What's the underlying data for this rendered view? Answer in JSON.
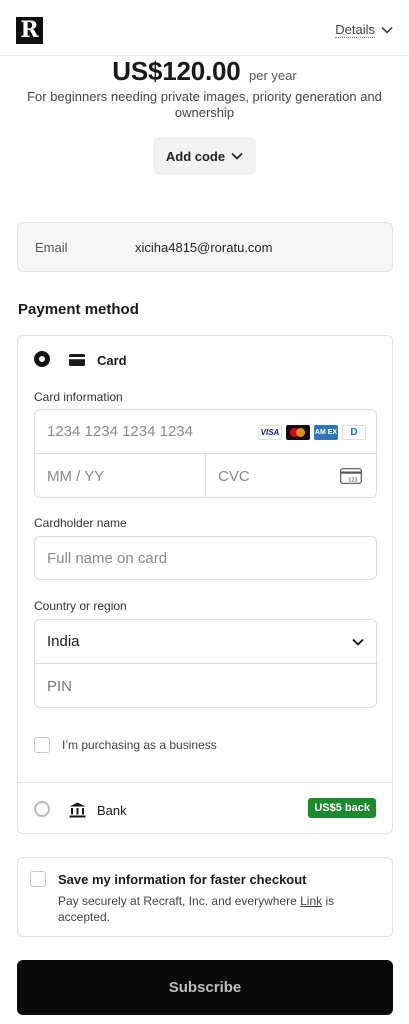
{
  "header": {
    "logo_text": "R",
    "details_label": "Details"
  },
  "plan": {
    "price": "US$120.00",
    "period": "per year",
    "description": "For beginners needing private images, priority generation and ownership",
    "add_code_label": "Add code"
  },
  "contact": {
    "email_label": "Email",
    "email_value": "xiciha4815@roratu.com"
  },
  "payment": {
    "title": "Payment method",
    "card": {
      "label": "Card",
      "selected": true,
      "card_info_label": "Card information",
      "number_placeholder": "1234 1234 1234 1234",
      "expiry_placeholder": "MM / YY",
      "cvc_placeholder": "CVC",
      "cvc_icon_text": "123",
      "brands": [
        "VISA",
        "Mastercard",
        "American Express",
        "Diners Club"
      ],
      "brand_visa_text": "VISA",
      "brand_amex_text": "AM EX",
      "brand_diners_text": "D",
      "cardholder_label": "Cardholder name",
      "cardholder_placeholder": "Full name on card",
      "country_label": "Country or region",
      "country_value": "India",
      "pin_placeholder": "PIN",
      "business_label": "I’m purchasing as a business"
    },
    "bank": {
      "label": "Bank",
      "badge": "US$5 back",
      "badge_color": "#1c8a2c"
    }
  },
  "save_info": {
    "title": "Save my information for faster checkout",
    "desc_prefix": "Pay securely at Recraft, Inc. and everywhere ",
    "desc_link": "Link",
    "desc_suffix": " is accepted."
  },
  "subscribe_label": "Subscribe",
  "colors": {
    "primary_button": "#0a0a0a",
    "badge_green": "#1c8a2c"
  }
}
